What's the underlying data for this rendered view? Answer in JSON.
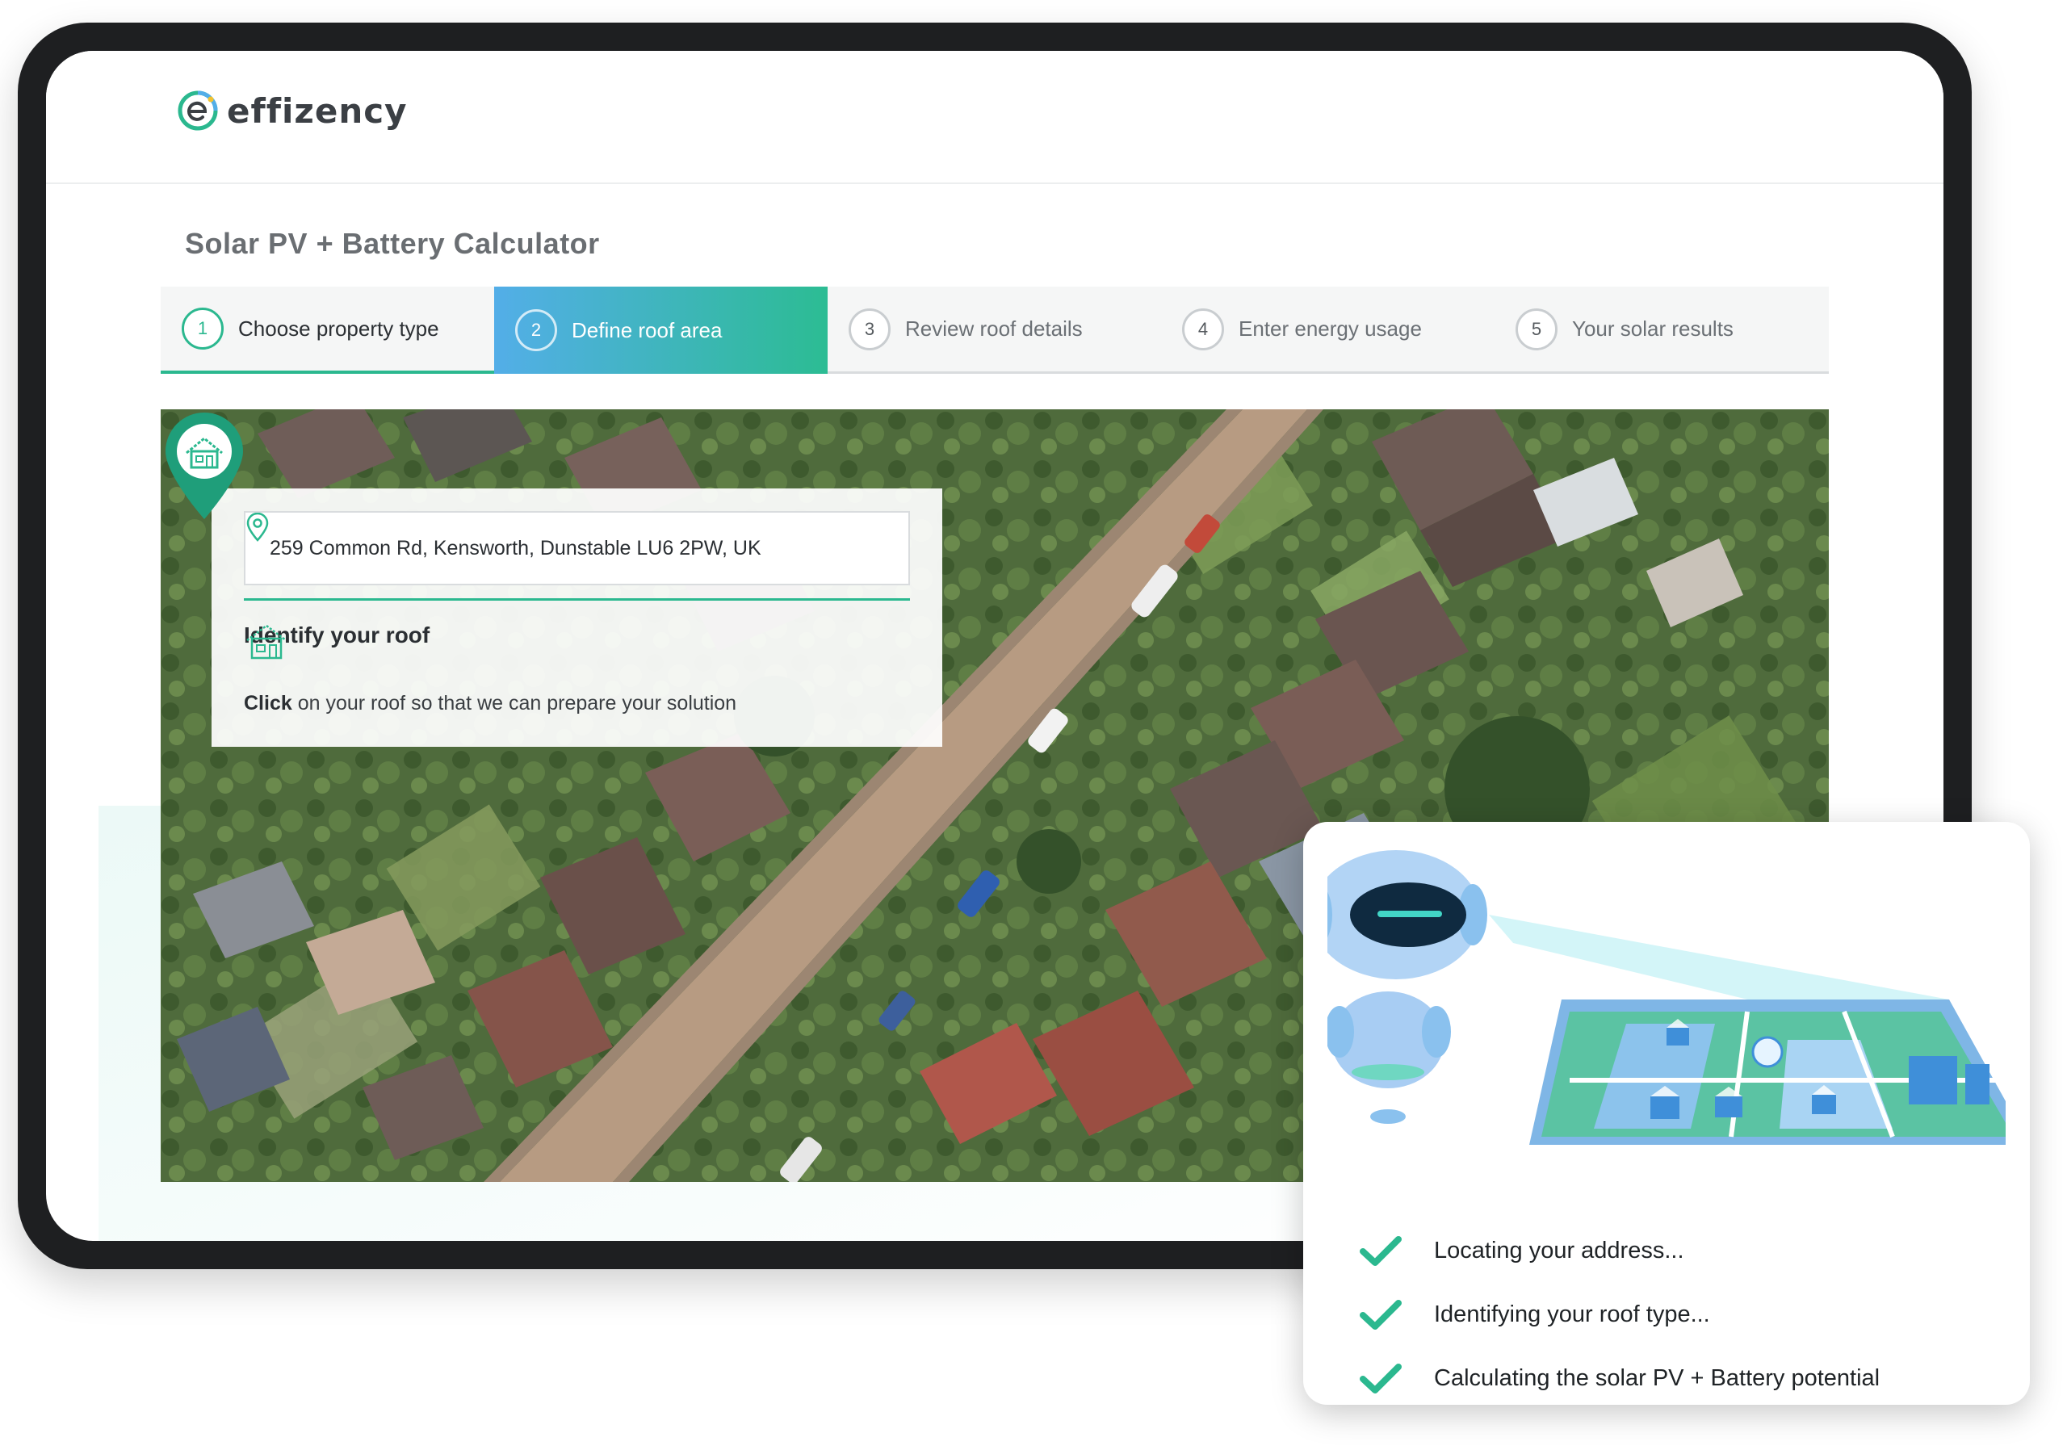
{
  "brand": {
    "name": "effizency"
  },
  "page": {
    "title": "Solar PV + Battery Calculator"
  },
  "steps": [
    {
      "number": "1",
      "label": "Choose property type",
      "state": "done"
    },
    {
      "number": "2",
      "label": "Define roof area",
      "state": "active"
    },
    {
      "number": "3",
      "label": "Review roof details",
      "state": "pending"
    },
    {
      "number": "4",
      "label": "Enter energy usage",
      "state": "pending"
    },
    {
      "number": "5",
      "label": "Your solar results",
      "state": "pending"
    }
  ],
  "address_card": {
    "address": "259 Common Rd, Kensworth, Dunstable LU6 2PW, UK",
    "title": "Identify your roof",
    "desc_bold": "Click",
    "desc_rest": " on your roof so that we can prepare your solution"
  },
  "ai_card": {
    "checklist": [
      "Locating your address...",
      "Identifying your roof type...",
      "Calculating the solar PV + Battery potential"
    ]
  },
  "colors": {
    "accent_green": "#2bb88f",
    "accent_blue": "#53aee8",
    "frame": "#1e1f21"
  },
  "icons": {
    "logo": "effizency-logo-icon",
    "location": "location-pin-icon",
    "house": "house-outline-icon",
    "marker": "map-marker-icon",
    "check": "checkmark-icon"
  }
}
